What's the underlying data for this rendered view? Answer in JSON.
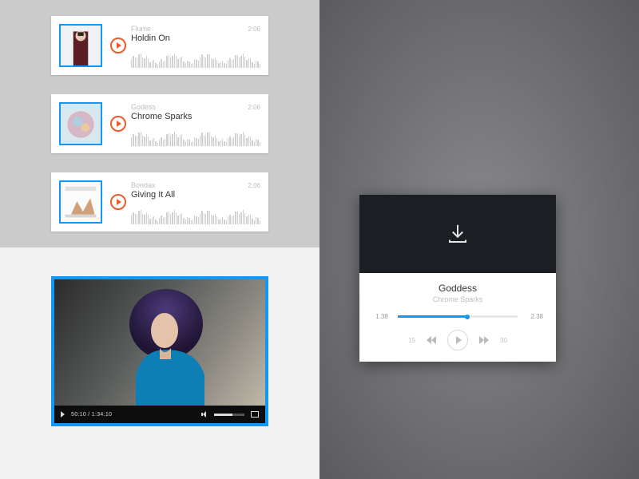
{
  "accent": "#1197f5",
  "tracks": [
    {
      "artist": "Flume",
      "title": "Holdin On",
      "duration": "2:06"
    },
    {
      "artist": "Godess",
      "title": "Chrome Sparks",
      "duration": "2:06"
    },
    {
      "artist": "Bondax",
      "title": "Giving It All",
      "duration": "2:06"
    }
  ],
  "video": {
    "current": "50:10",
    "total": "1:34:10"
  },
  "player": {
    "title": "Goddess",
    "artist": "Chrome Sparks",
    "elapsed": "1.38",
    "total": "2.38",
    "progress_pct": 58,
    "rewind_label": "15",
    "forward_label": "30"
  }
}
